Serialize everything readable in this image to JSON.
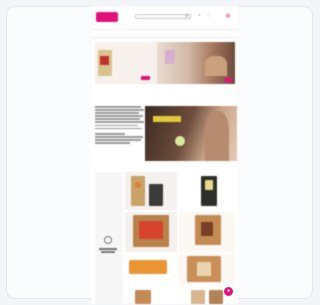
{
  "header": {
    "logo_text": "",
    "search_placeholder": "",
    "icons": [
      "search-icon",
      "user-icon",
      "heart-icon",
      "cart-icon"
    ]
  },
  "nav": {
    "items": [
      "",
      "",
      "",
      "",
      "",
      "",
      "",
      "",
      ""
    ]
  },
  "hero": {
    "heading": "",
    "subtext": ""
  },
  "about": {
    "title": ""
  },
  "grid": {
    "icon": "gift-icon"
  },
  "colors": {
    "brand": "#e3127b",
    "background": "#f3f5f8"
  }
}
